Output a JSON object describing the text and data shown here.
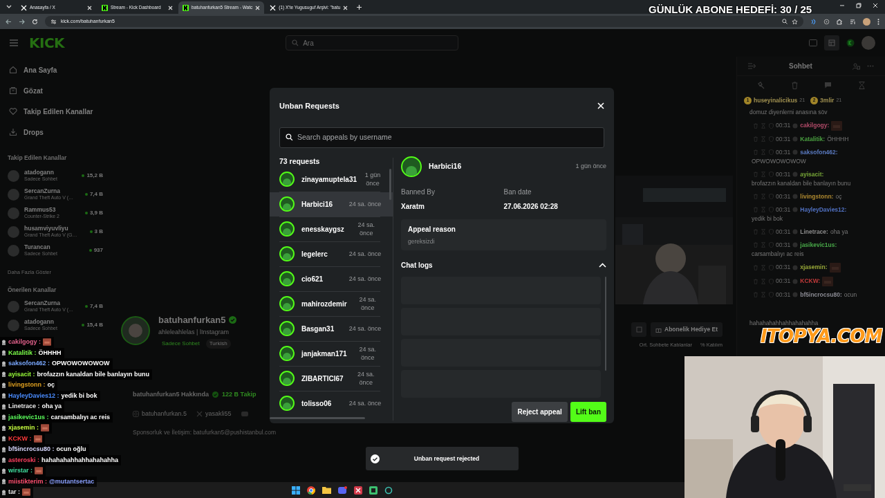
{
  "browser": {
    "tabs": [
      {
        "title": "Anasayfa / X",
        "kind": "x",
        "selected": false
      },
      {
        "title": "Stream - Kick Dashboard",
        "kind": "kick",
        "selected": false
      },
      {
        "title": "batuhanfurkan5 Stream - Watc",
        "kind": "kick",
        "selected": true
      },
      {
        "title": "(1) X'te Yugusuguf Arşivi: \"batu",
        "kind": "x",
        "selected": false
      }
    ],
    "url": "kick.com/batuhanfurkan5"
  },
  "goal_overlay": "GÜNLÜK ABONE HEDEFİ: 30 / 25",
  "header": {
    "logo": "KICK",
    "search_placeholder": "Ara"
  },
  "sidebar": {
    "nav": [
      {
        "label": "Ana Sayfa",
        "kind": "home"
      },
      {
        "label": "Gözat",
        "kind": "browse"
      },
      {
        "label": "Takip Edilen Kanallar",
        "kind": "heart"
      },
      {
        "label": "Drops",
        "kind": "drops"
      }
    ],
    "followed_title": "Takip Edilen Kanallar",
    "followed": [
      {
        "name": "atadogann",
        "sub": "Sadece Sohbet",
        "viewers": "15,2 B"
      },
      {
        "name": "SercanZurna",
        "sub": "Grand Theft Auto V (…",
        "viewers": "7,4 B"
      },
      {
        "name": "Rammus53",
        "sub": "Counter-Strike 2",
        "viewers": "3,9 B"
      },
      {
        "name": "husamviyuvliyu",
        "sub": "Grand Theft Auto V (G…",
        "viewers": "3 B"
      },
      {
        "name": "Turancan",
        "sub": "Sadece Sohbet",
        "viewers": "937"
      }
    ],
    "more": "Daha Fazla Göster",
    "recommended_title": "Önerilen Kanallar",
    "recommended": [
      {
        "name": "SercanZurna",
        "sub": "Grand Theft Auto V (…",
        "viewers": "7,4 B"
      },
      {
        "name": "atadogann",
        "sub": "Sadece Sohbet",
        "viewers": "15,4 B"
      }
    ]
  },
  "channel": {
    "name": "batuhanfurkan5",
    "bio": "ahleleahlelas | lInstagram",
    "tags": [
      "Sadece Sohbet",
      "Turkish"
    ],
    "gift_button": "Abonelik Hediye Et",
    "stats": [
      "Ort. Sohbete Katılanlar",
      "% Katılım"
    ],
    "about_title": "batuhanfurkan5 Hakkında",
    "followers": "122 B Takip",
    "socials": [
      {
        "kind": "instagram",
        "label": "batuhanfurkan.5"
      },
      {
        "kind": "x",
        "label": "yasakli55"
      }
    ],
    "sponsor": "Sponsorluk ve İletişim: batufurkan5@pushistanbul.com"
  },
  "modal": {
    "title": "Unban Requests",
    "search_placeholder": "Search appeals by username",
    "count": "73 requests",
    "requests": [
      {
        "name": "zinayamuptela31",
        "time": "1 gün önce",
        "selected": false
      },
      {
        "name": "Harbici16",
        "time": "24 sa. önce",
        "selected": true
      },
      {
        "name": "enesskaygsz",
        "time": "24 sa. önce",
        "selected": false
      },
      {
        "name": "legelerc",
        "time": "24 sa. önce",
        "selected": false
      },
      {
        "name": "cio621",
        "time": "24 sa. önce",
        "selected": false
      },
      {
        "name": "mahirozdemir",
        "time": "24 sa. önce",
        "selected": false
      },
      {
        "name": "Basgan31",
        "time": "24 sa. önce",
        "selected": false
      },
      {
        "name": "janjakman171",
        "time": "24 sa. önce",
        "selected": false
      },
      {
        "name": "ZIBARTICI67",
        "time": "24 sa. önce",
        "selected": false
      },
      {
        "name": "tolisso06",
        "time": "24 sa. önce",
        "selected": false
      }
    ],
    "detail": {
      "name": "Harbici16",
      "time": "1 gün önce",
      "banned_by_label": "Banned By",
      "banned_by": "Xaratm",
      "ban_date_label": "Ban date",
      "ban_date": "27.06.2026 02:28",
      "appeal_label": "Appeal reason",
      "appeal_text": "gereksizdi",
      "chat_logs_label": "Chat logs",
      "chat_logs_expanded": true
    },
    "buttons": [
      {
        "label": "Reject appeal",
        "kind": "secondary"
      },
      {
        "label": "Lift ban",
        "kind": "primary"
      }
    ]
  },
  "toast": "Unban request rejected",
  "chat": {
    "title": "Sohbet",
    "leaderboard": [
      {
        "rank": "1",
        "name": "huseyinalicikus",
        "count": "21"
      },
      {
        "rank": "2",
        "name": "3mlir",
        "count": "21"
      }
    ],
    "pinned": "domuz diyenlerni anasına söv",
    "messages": [
      {
        "time": "00:31",
        "user": "cakilgogy:",
        "color": "#b04a68",
        "emote": true
      },
      {
        "time": "00:31",
        "user": "Katalitik:",
        "color": "#4aa040",
        "text": "ÖHHHH"
      },
      {
        "time": "00:31",
        "user": "saksofon462:",
        "color": "#5a7ac0",
        "text": "OPWOWOWOWOW"
      },
      {
        "time": "00:31",
        "user": "ayisacit:",
        "color": "#78a838",
        "text": "brofazzın kanaldan bile banlayın bunu"
      },
      {
        "time": "00:31",
        "user": "livingstonn:",
        "color": "#b08a30",
        "text": "oç"
      },
      {
        "time": "00:31",
        "user": "HayleyDavies12:",
        "color": "#5070c0",
        "text": "yedik bi bok"
      },
      {
        "time": "00:31",
        "user": "Linetrace:",
        "color": "#8a8a8a",
        "text": "oha ya"
      },
      {
        "time": "00:31",
        "user": "jasikevic1us:",
        "color": "#48a848",
        "text": "carsambalıyı ac reis"
      },
      {
        "time": "00:31",
        "user": "xjasemin:",
        "color": "#98a838",
        "emote": true
      },
      {
        "time": "00:31",
        "user": "KCKW:",
        "color": "#c03a3a",
        "emote": true
      },
      {
        "time": "00:31",
        "user": "bf5incrocsu80:",
        "color": "#8a8a92",
        "text": "ocun"
      }
    ],
    "last_text": "hahahahahhahhahahahha"
  },
  "sponsor_logo": "ITOPYA.COM",
  "overlay_chat": [
    {
      "user": "cakilgogy :",
      "color": "#e0608a",
      "emote": true
    },
    {
      "user": "Katalitik :",
      "color": "#7dff4a",
      "text": "ÖHHHH"
    },
    {
      "user": "saksofon462 :",
      "color": "#7aa8ff",
      "text": "OPWOWOWOWOW"
    },
    {
      "user": "ayisacit :",
      "color": "#9aff3a",
      "text": "brofazzın kanaldan bile banlayın bunu"
    },
    {
      "user": "livingstonn :",
      "color": "#e0a020",
      "text": "oç"
    },
    {
      "user": "HayleyDavies12 :",
      "color": "#4a8cff",
      "text": "yedik bi bok"
    },
    {
      "user": "Linetrace :",
      "color": "#e8e8e8",
      "text": "oha ya"
    },
    {
      "user": "jasikevic1us :",
      "color": "#5cff5c",
      "text": "carsambalıyı ac reis"
    },
    {
      "user": "xjasemin :",
      "color": "#c8ff40",
      "emote": true
    },
    {
      "user": "KCKW :",
      "color": "#ff3a3a",
      "emote": true
    },
    {
      "user": "bf5incrocsu80 :",
      "color": "#d8d8ff",
      "text": "ocun oğlu"
    },
    {
      "user": "asteroski :",
      "color": "#ff4060",
      "text": "hahahahahhahhahahahha"
    },
    {
      "user": "wirstar :",
      "color": "#40e0a0",
      "emote": true
    },
    {
      "user": "miistikterim :",
      "color": "#ff5070",
      "text": "@mutantsertac"
    },
    {
      "user": "tar :",
      "color": "#e8e8e8",
      "emote": true
    }
  ]
}
